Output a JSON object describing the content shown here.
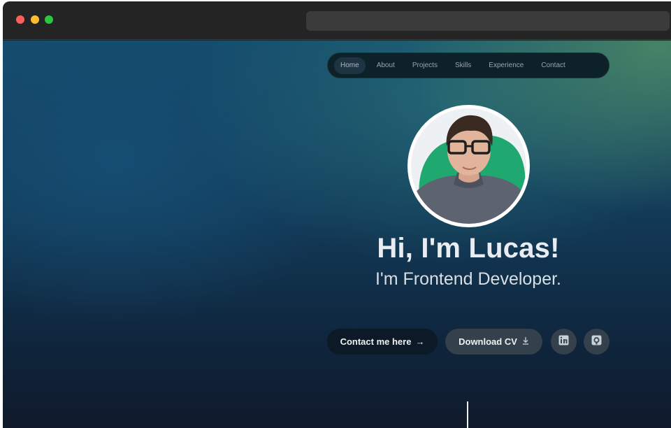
{
  "window": {
    "controls": [
      "close",
      "minimize",
      "maximize"
    ],
    "url": ""
  },
  "nav": {
    "items": [
      {
        "label": "Home",
        "active": true
      },
      {
        "label": "About"
      },
      {
        "label": "Projects"
      },
      {
        "label": "Skills"
      },
      {
        "label": "Experience"
      },
      {
        "label": "Contact"
      }
    ]
  },
  "hero": {
    "avatar_alt": "avatar",
    "title": "Hi, I'm Lucas!",
    "subtitle": "I'm Frontend Developer."
  },
  "actions": {
    "contact_label": "Contact me here",
    "contact_icon": "arrow-right-icon",
    "download_label": "Download CV",
    "download_icon": "download-icon",
    "social": [
      {
        "name": "linkedin-icon"
      },
      {
        "name": "github-icon"
      }
    ]
  },
  "colors": {
    "accent_green": "#1fa971",
    "text_light": "#e9edf1",
    "button_dark": "#0b1a26",
    "button_gray": "#34404b"
  }
}
